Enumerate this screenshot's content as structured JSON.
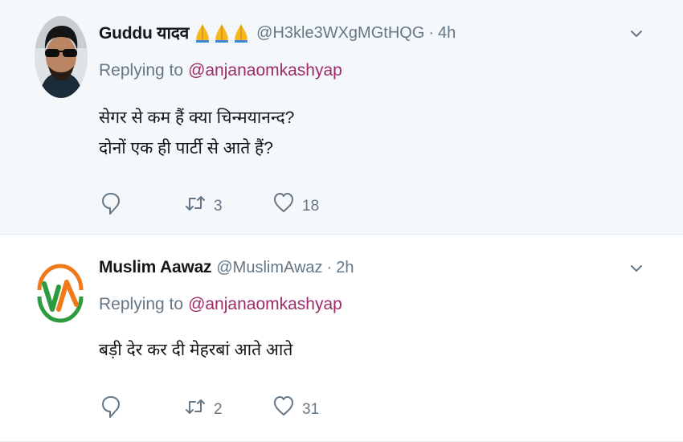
{
  "tweets": [
    {
      "name": "Guddu यादव",
      "name_emoji_icon": "folded-hands-icon",
      "handle": "@H3kle3WXgMGtHQG",
      "separator": "·",
      "time": "4h",
      "replying_prefix": "Replying to",
      "replying_to": "@anjanaomkashyap",
      "body_lines": [
        "सेगर से कम हैं क्या चिन्मयानन्द?",
        "दोनों एक ही पार्टी से आते हैं?"
      ],
      "actions": {
        "reply_icon": "reply-icon",
        "retweet_icon": "retweet-icon",
        "retweet_count": "3",
        "like_icon": "heart-icon",
        "like_count": "18"
      }
    },
    {
      "name": "Muslim Aawaz",
      "handle": "@MuslimAwaz",
      "separator": "·",
      "time": "2h",
      "replying_prefix": "Replying to",
      "replying_to": "@anjanaomkashyap",
      "body_lines": [
        "बड़ी देर कर दी मेहरबां आते आते"
      ],
      "actions": {
        "reply_icon": "reply-icon",
        "retweet_icon": "retweet-icon",
        "retweet_count": "2",
        "like_icon": "heart-icon",
        "like_count": "31"
      }
    }
  ],
  "colors": {
    "mention": "#9c2a66",
    "secondary_text": "#657786",
    "highlight_bg": "#f5f8fa",
    "logo_orange": "#f07a1a",
    "logo_green": "#2e9a3e"
  }
}
